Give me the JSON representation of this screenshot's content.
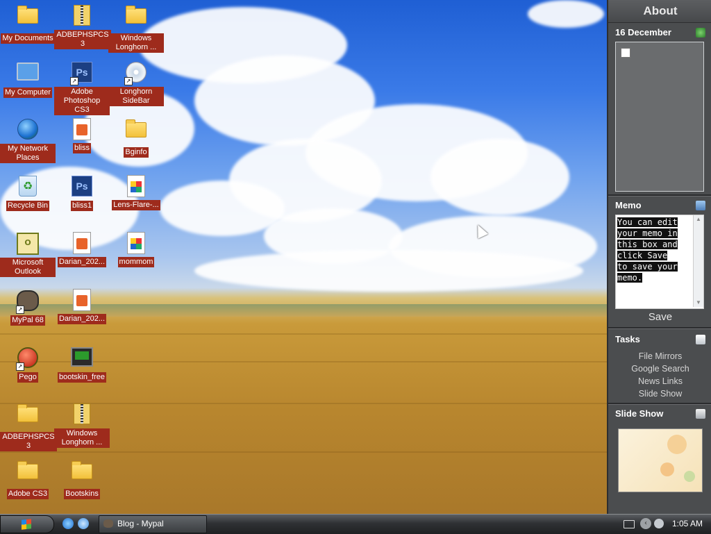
{
  "desktop": {
    "icons": [
      {
        "label": "My Documents",
        "icon": "folder-documents-icon"
      },
      {
        "label": "ADBEPHSPCS3",
        "icon": "zip-folder-icon"
      },
      {
        "label": "Windows Longhorn ...",
        "icon": "folder-icon"
      },
      {
        "label": "My Computer",
        "icon": "computer-icon"
      },
      {
        "label": "Adobe Photoshop CS3",
        "icon": "photoshop-icon"
      },
      {
        "label": "Longhorn SideBar",
        "icon": "cd-icon"
      },
      {
        "label": "My Network Places",
        "icon": "network-globe-icon"
      },
      {
        "label": "bliss",
        "icon": "image-file-icon"
      },
      {
        "label": "Bginfo",
        "icon": "folder-icon"
      },
      {
        "label": "Recycle Bin",
        "icon": "recycle-bin-icon"
      },
      {
        "label": "bliss1",
        "icon": "psd-file-icon"
      },
      {
        "label": "Lens-Flare-...",
        "icon": "image-file-icon"
      },
      {
        "label": "Microsoft Outlook",
        "icon": "outlook-icon"
      },
      {
        "label": "Darian_202...",
        "icon": "image-file-icon"
      },
      {
        "label": "mommom",
        "icon": "image-file-icon"
      },
      {
        "label": "MyPal 68",
        "icon": "mypal-icon"
      },
      {
        "label": "Darian_202...",
        "icon": "image-file-icon"
      },
      {
        "label": "Pego",
        "icon": "pego-icon"
      },
      {
        "label": "bootskin_free",
        "icon": "bootskin-icon"
      },
      {
        "label": "ADBEPHSPCS3",
        "icon": "folder-icon"
      },
      {
        "label": "Windows Longhorn ...",
        "icon": "zip-folder-icon"
      },
      {
        "label": "Adobe CS3",
        "icon": "folder-icon"
      },
      {
        "label": "Bootskins",
        "icon": "folder-icon"
      }
    ]
  },
  "sidebar": {
    "about": "About",
    "calendar": {
      "title": "16 December"
    },
    "memo": {
      "title": "Memo",
      "lines": [
        "You can edit",
        "your memo in",
        "this box and",
        "click Save",
        "to save your",
        "memo."
      ],
      "save_label": "Save"
    },
    "tasks": {
      "title": "Tasks",
      "items": [
        "File Mirrors",
        "Google Search",
        "News Links",
        "Slide Show"
      ]
    },
    "slideshow": {
      "title": "Slide Show"
    }
  },
  "taskbar": {
    "window_button": "Blog - Mypal",
    "clock": "1:05 AM"
  },
  "colors": {
    "icon_label_bg": "#9e2b1c",
    "sidebar_bg": "#4b4d4f",
    "taskbar_bg": "#2f3134"
  }
}
